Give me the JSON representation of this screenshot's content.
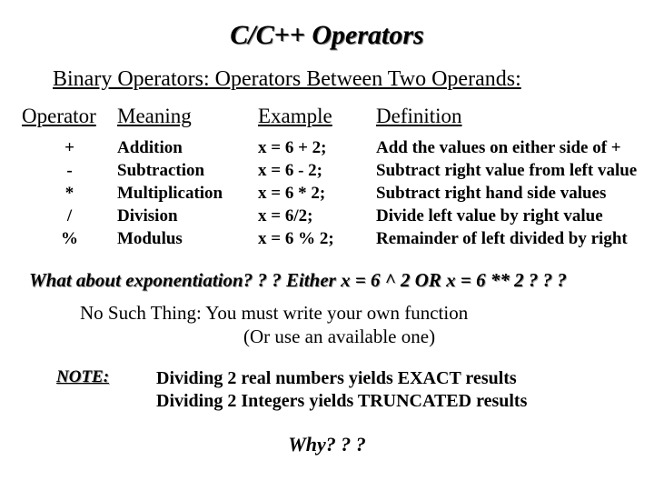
{
  "title": "C/C++  Operators",
  "subtitle": "Binary Operators:  Operators Between Two Operands:",
  "headers": {
    "operator": "Operator",
    "meaning": "Meaning",
    "example": "Example",
    "definition": "Definition"
  },
  "rows": [
    {
      "operator": "+",
      "meaning": "Addition",
      "example": "x = 6 + 2;",
      "definition": "Add the values on either side of +"
    },
    {
      "operator": "-",
      "meaning": "Subtraction",
      "example": "x = 6 - 2;",
      "definition": "Subtract right value from left value"
    },
    {
      "operator": "*",
      "meaning": "Multiplication",
      "example": "x = 6 * 2;",
      "definition": "Subtract right hand side values"
    },
    {
      "operator": "/",
      "meaning": "Division",
      "example": "x = 6/2;",
      "definition": "Divide left value by right value"
    },
    {
      "operator": "%",
      "meaning": "Modulus",
      "example": "x = 6 % 2;",
      "definition": "Remainder of left divided by right"
    }
  ],
  "exponent_question": "What about exponentiation? ? ? Either  x = 6 ^ 2  OR  x = 6 ** 2  ? ? ?",
  "no_such_line1": "No Such Thing:  You must write your own function",
  "no_such_line2": "(Or use an available one)",
  "note_label": "NOTE:",
  "note_line1": "Dividing 2 real numbers yields EXACT results",
  "note_line2": "Dividing 2 Integers yields TRUNCATED results",
  "why": "Why? ? ?"
}
